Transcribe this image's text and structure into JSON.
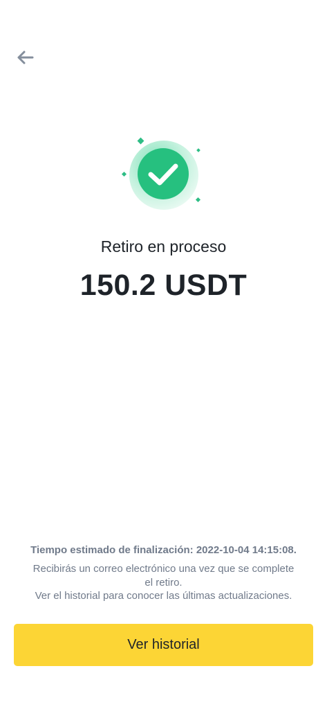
{
  "header": {
    "back_icon": "arrow-left-icon"
  },
  "status": {
    "icon": "check-circle-icon",
    "title": "Retiro en proceso",
    "amount": "150.2 USDT",
    "accent_color": "#2ebd85"
  },
  "info": {
    "eta": "Tiempo estimado de finalización: 2022-10-04 14:15:08.",
    "email_note_line1": "Recibirás un correo electrónico una vez que se complete",
    "email_note_line2": "el retiro.",
    "history_note": "Ver el historial para conocer las últimas actualizaciones."
  },
  "actions": {
    "history_button_label": "Ver historial",
    "history_button_color": "#fcd535"
  }
}
